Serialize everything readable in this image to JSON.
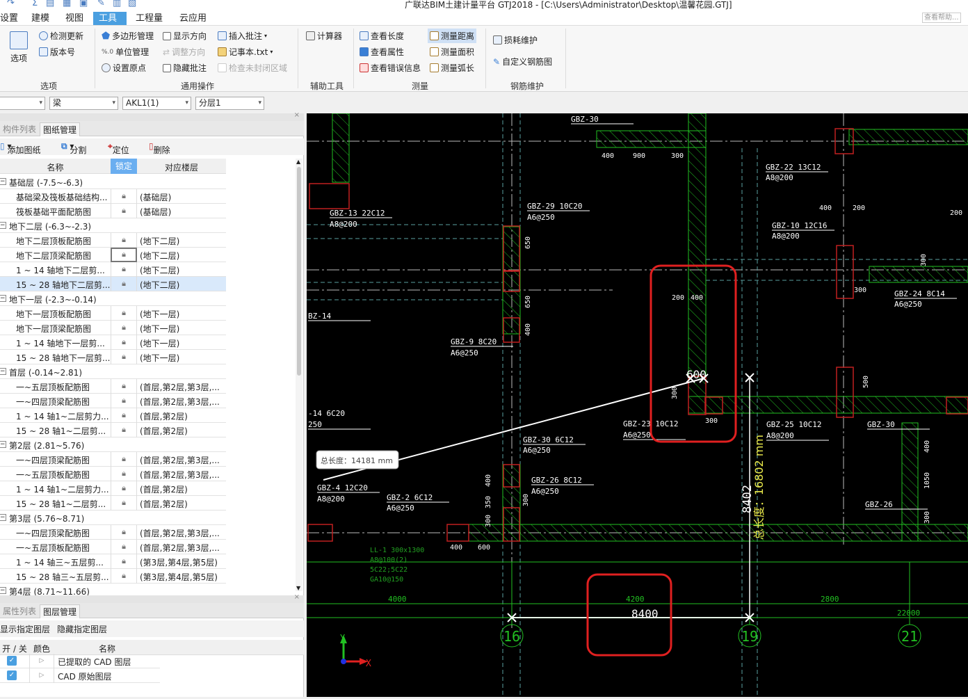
{
  "window": {
    "title": "广联达BIM土建计量平台 GTJ2018 - [C:\\Users\\Administrator\\Desktop\\温馨花园.GTJ]",
    "search_hint": "查看帮助..."
  },
  "menu_tabs": [
    "设置",
    "建模",
    "视图",
    "工具",
    "工程量",
    "云应用"
  ],
  "active_tab": "工具",
  "ribbon": {
    "options": {
      "options_label": "选项",
      "check_update": "检测更新",
      "version": "版本号",
      "group": "选项"
    },
    "general": {
      "polygon": "多边形管理",
      "unit": "单位管理",
      "origin": "设置原点",
      "show_dir": "显示方向",
      "adjust_dir": "调整方向",
      "hide_note": "隐藏批注",
      "insert_note": "插入批注",
      "notepad": "记事本.txt",
      "check_closed": "检查未封闭区域",
      "group": "通用操作"
    },
    "aux": {
      "calculator": "计算器",
      "group": "辅助工具"
    },
    "measure": {
      "view_length": "查看长度",
      "view_attr": "查看属性",
      "view_error": "查看错误信息",
      "measure_distance": "测量距离",
      "measure_area": "测量面积",
      "measure_arc": "测量弧长",
      "group": "测量"
    },
    "rebar": {
      "loss": "损耗维护",
      "custom_rebar": "自定义钢筋图",
      "group": "钢筋维护"
    }
  },
  "selectors": {
    "s1": "",
    "s2": "梁",
    "s3": "AKL1(1)",
    "s4": "分层1"
  },
  "drawing_panel": {
    "tabs": [
      "构件列表",
      "图纸管理"
    ],
    "active": "图纸管理",
    "toolbar": {
      "add": "添加图纸",
      "split": "分割",
      "locate": "定位",
      "delete": "删除"
    },
    "columns": [
      "名称",
      "锁定",
      "对应楼层"
    ],
    "rows": [
      {
        "group": true,
        "name": "基础层 (-7.5~-6.3)"
      },
      {
        "name": "基础梁及筏板基础结构...",
        "floor": "(基础层)"
      },
      {
        "name": "筏板基础平面配筋图",
        "floor": "(基础层)"
      },
      {
        "group": true,
        "name": "地下二层 (-6.3~-2.3)"
      },
      {
        "name": "地下二层顶板配筋图",
        "floor": "(地下二层)"
      },
      {
        "name": "地下二层顶梁配筋图",
        "floor": "(地下二层)"
      },
      {
        "name": "1 ~ 14 轴地下二层剪...",
        "floor": "(地下二层)"
      },
      {
        "name": "15 ~ 28 轴地下二层剪...",
        "floor": "(地下二层)",
        "selected": true
      },
      {
        "group": true,
        "name": "地下一层 (-2.3~-0.14)"
      },
      {
        "name": "地下一层顶板配筋图",
        "floor": "(地下一层)"
      },
      {
        "name": "地下一层顶梁配筋图",
        "floor": "(地下一层)"
      },
      {
        "name": "1 ~ 14 轴地下一层剪...",
        "floor": "(地下一层)"
      },
      {
        "name": "15 ~ 28 轴地下一层剪...",
        "floor": "(地下一层)"
      },
      {
        "group": true,
        "name": "首层 (-0.14~2.81)"
      },
      {
        "name": "一~五层顶板配筋图",
        "floor": "(首层,第2层,第3层,..."
      },
      {
        "name": "一~四层顶梁配筋图",
        "floor": "(首层,第2层,第3层,..."
      },
      {
        "name": "1 ~ 14 轴1~二层剪力...",
        "floor": "(首层,第2层)"
      },
      {
        "name": "15 ~ 28 轴1~二层剪...",
        "floor": "(首层,第2层)"
      },
      {
        "group": true,
        "name": "第2层 (2.81~5.76)"
      },
      {
        "name": "一~四层顶梁配筋图",
        "floor": "(首层,第2层,第3层,..."
      },
      {
        "name": "一~五层顶板配筋图",
        "floor": "(首层,第2层,第3层,..."
      },
      {
        "name": "1 ~ 14 轴1~二层剪力...",
        "floor": "(首层,第2层)"
      },
      {
        "name": "15 ~ 28 轴1~二层剪...",
        "floor": "(首层,第2层)"
      },
      {
        "group": true,
        "name": "第3层 (5.76~8.71)"
      },
      {
        "name": "一~四层顶梁配筋图",
        "floor": "(首层,第2层,第3层,..."
      },
      {
        "name": "一~五层顶板配筋图",
        "floor": "(首层,第2层,第3层,..."
      },
      {
        "name": "1 ~ 14 轴三~五层剪...",
        "floor": "(第3层,第4层,第5层)"
      },
      {
        "name": "15 ~ 28 轴三~五层剪...",
        "floor": "(第3层,第4层,第5层)"
      },
      {
        "group": true,
        "name": "第4层 (8.71~11.66)"
      }
    ]
  },
  "layer_panel": {
    "tabs": [
      "属性列表",
      "图层管理"
    ],
    "active": "图层管理",
    "toolbar": {
      "show": "显示指定图层",
      "hide": "隐藏指定图层"
    },
    "columns": [
      "开 / 关",
      "颜色",
      "名称"
    ],
    "rows": [
      {
        "name": "已提取的 CAD 图层",
        "on": true
      },
      {
        "name": "CAD 原始图层",
        "on": true
      }
    ]
  },
  "cad": {
    "labels": [
      "GBZ-30",
      "GBZ-13 22C12",
      "A8@200",
      "GBZ-29 10C20",
      "A6@250",
      "GBZ-22 13C12",
      "A8@200",
      "GBZ-10 12C16",
      "A8@200",
      "GBZ-24 8C14",
      "A6@250",
      "GBZ-9 8C20",
      "A6@250",
      "BZ-14",
      "-14 6C20",
      "250",
      "GBZ-23 10C12",
      "A6@250",
      "GBZ-25 10C12",
      "A8@200",
      "GBZ-30",
      "GBZ-30 6C12",
      "A6@250",
      "GBZ-26 8C12",
      "A6@250",
      "GBZ-4 12C20",
      "A8@200",
      "GBZ-2 6C12",
      "A6@250",
      "GBZ-26"
    ],
    "dims": [
      "400",
      "900",
      "300",
      "200",
      "400",
      "400",
      "200",
      "200",
      "300",
      "300",
      "400",
      "600",
      "650",
      "650",
      "400",
      "300",
      "300",
      "500",
      "400",
      "350",
      "300",
      "400",
      "1050",
      "300",
      "300"
    ],
    "beam_notes": [
      "LL-1 300x1300",
      "A8@100(2)",
      "5C22;5C22",
      "GA10@150"
    ],
    "axis_dims": {
      "d1": "4000",
      "d2": "4200",
      "d3": "2800",
      "total": "22000"
    },
    "axes": [
      "16",
      "19",
      "21"
    ],
    "measure": {
      "horizontal": "8400",
      "vertical": "8402",
      "point_label": "600",
      "total_vertical": "总长度：16802 mm",
      "tooltip": "总长度：14181 mm"
    },
    "ucs": {
      "x": "X",
      "y": "Y"
    },
    "colors": {
      "wall": "#22c022",
      "column": "#c02020",
      "highlight": "#e02020",
      "measure_text": "#e8e84a",
      "background": "#000000"
    }
  }
}
